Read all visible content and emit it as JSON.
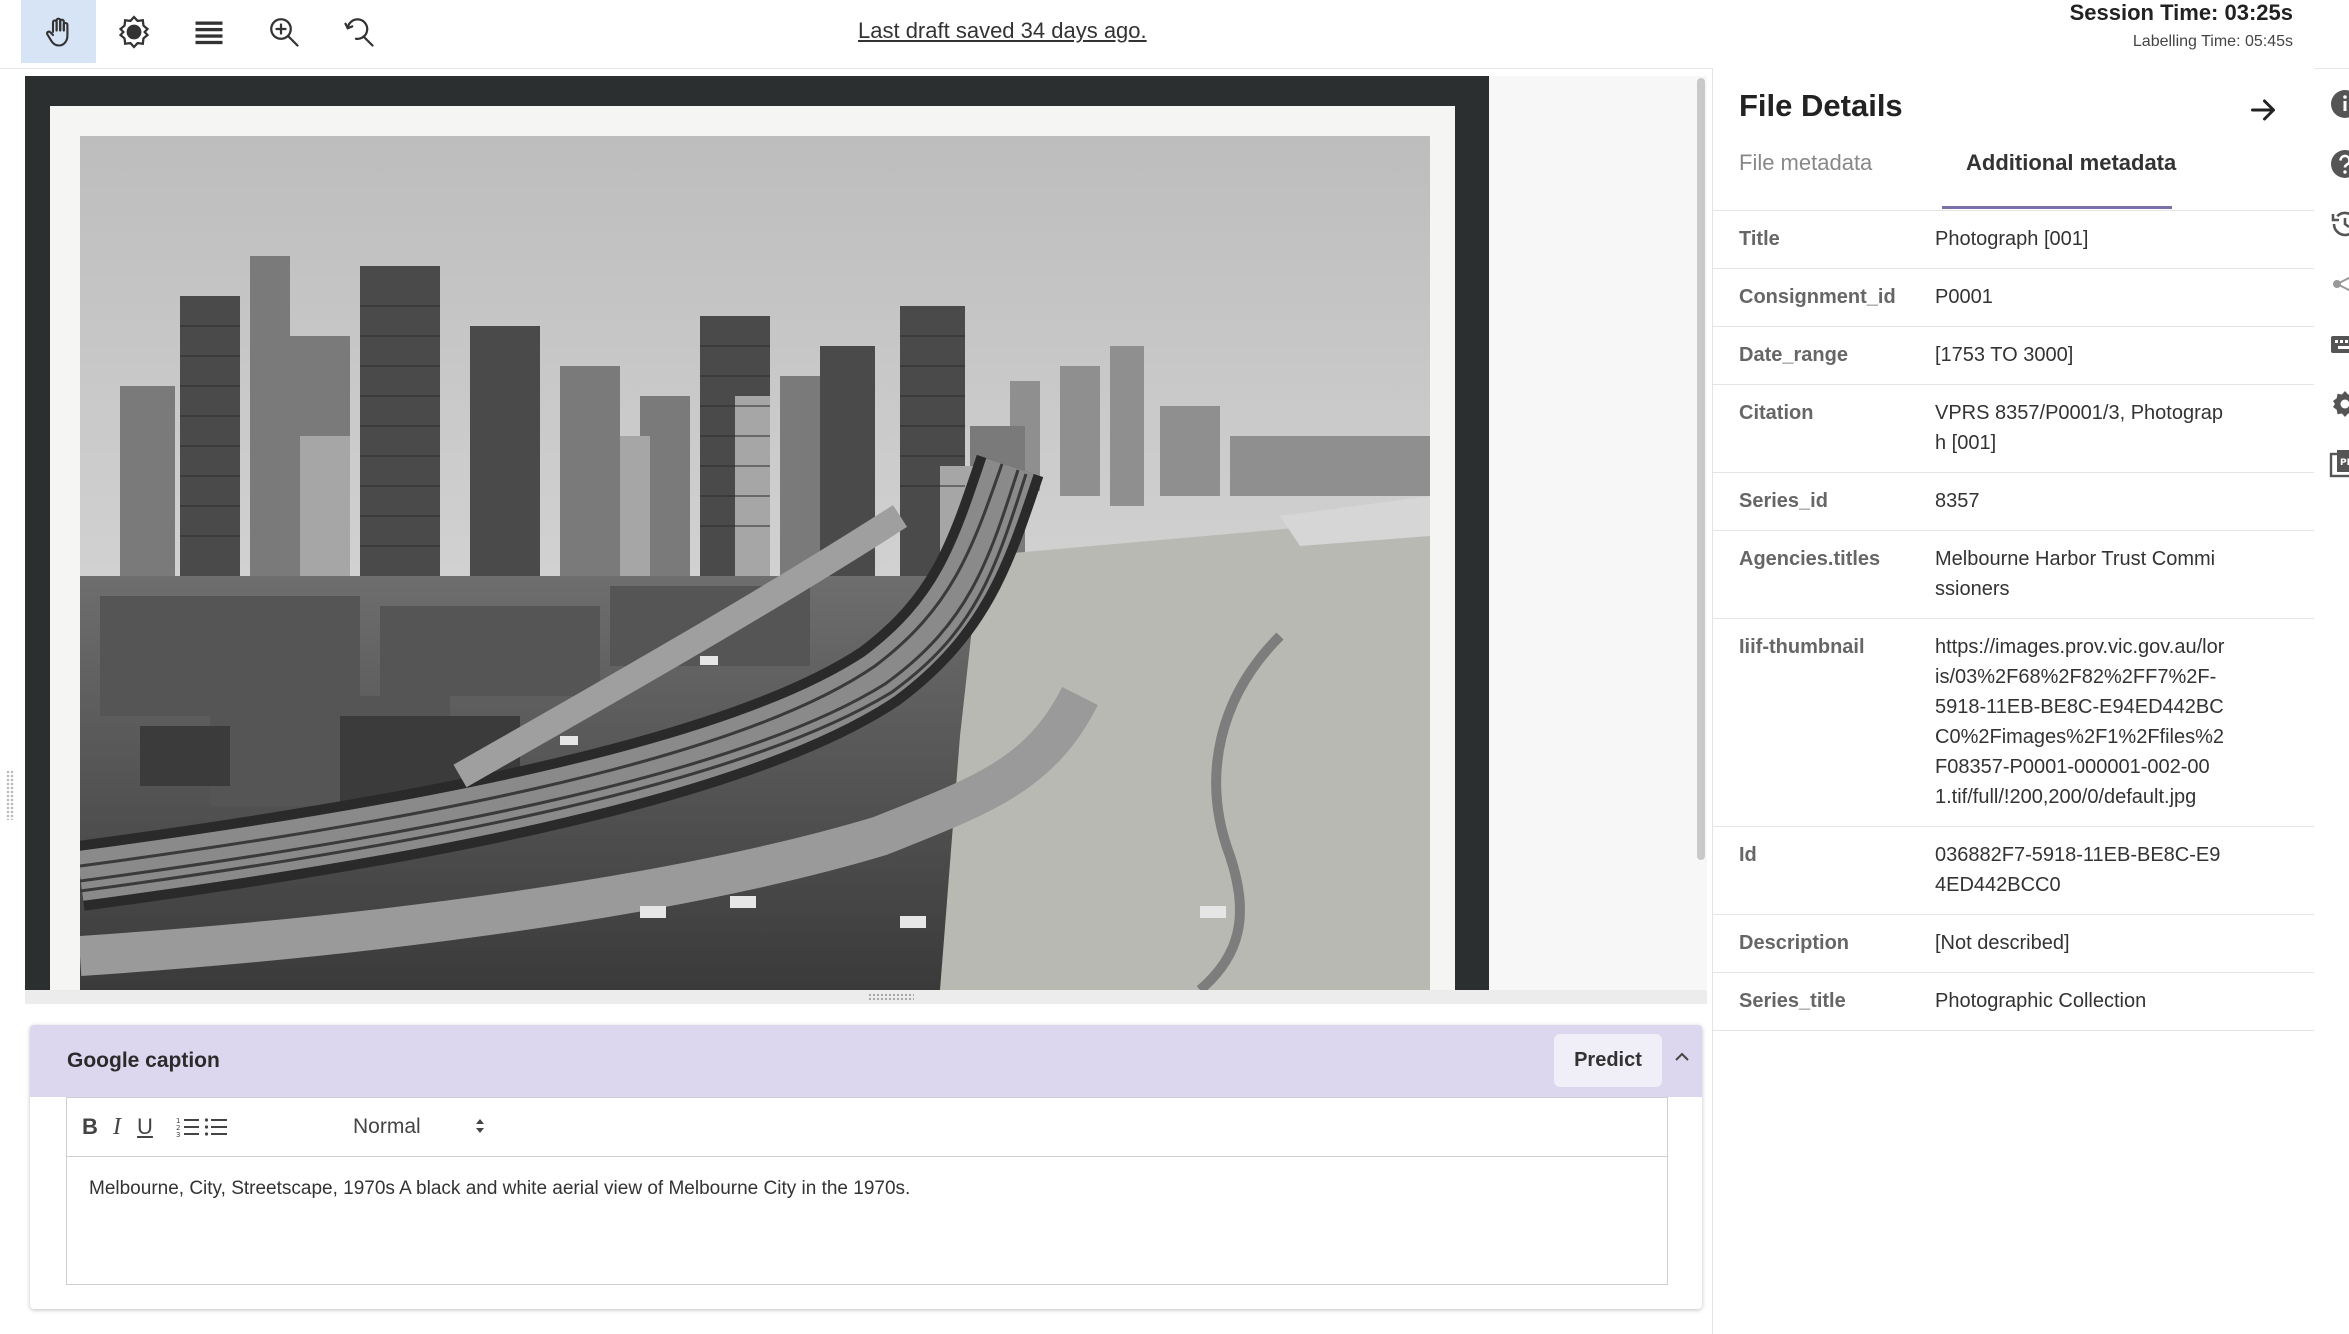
{
  "toolbar": {
    "tools": [
      {
        "name": "pan",
        "icon": "hand-icon",
        "active": true
      },
      {
        "name": "brightness",
        "icon": "brightness-icon",
        "active": false
      },
      {
        "name": "layers",
        "icon": "layers-icon",
        "active": false
      },
      {
        "name": "zoom-in",
        "icon": "zoom-in-icon",
        "active": false
      },
      {
        "name": "zoom-reset",
        "icon": "zoom-reset-icon",
        "active": false
      }
    ],
    "draft_status": "Last draft saved 34 days ago.",
    "session_time": "Session Time: 03:25s",
    "labelling_time": "Labelling Time: 05:45s"
  },
  "caption": {
    "title": "Google caption",
    "predict_label": "Predict",
    "style_value": "Normal",
    "text": "Melbourne, City, Streetscape, 1970s A black and white aerial view of Melbourne City in the 1970s.",
    "format_buttons": [
      {
        "label": "B",
        "icon": "bold-icon"
      },
      {
        "label": "I",
        "icon": "italic-icon"
      },
      {
        "label": "U",
        "icon": "underline-icon"
      }
    ]
  },
  "details": {
    "title": "File Details",
    "tabs": [
      {
        "label": "File metadata",
        "active": false
      },
      {
        "label": "Additional metadata",
        "active": true
      }
    ],
    "rows": [
      {
        "key": "Title",
        "value": "Photograph [001]"
      },
      {
        "key": "Consignment_id",
        "value": "P0001"
      },
      {
        "key": "Date_range",
        "value": "[1753 TO 3000]"
      },
      {
        "key": "Citation",
        "value": "VPRS 8357/P0001/3, Photograph [001]"
      },
      {
        "key": "Series_id",
        "value": "8357"
      },
      {
        "key": "Agencies.titles",
        "value": "Melbourne Harbor Trust Commissioners"
      },
      {
        "key": "Iiif-thumbnail",
        "value": "https://images.prov.vic.gov.au/loris/03%2F68%2F82%2FF7%2F-5918-11EB-BE8C-E94ED442BCC0%2Fimages%2F1%2Ffiles%2F08357-P0001-000001-002-001.tif/full/!200,200/0/default.jpg"
      },
      {
        "key": "Id",
        "value": "036882F7-5918-11EB-BE8C-E94ED442BCC0"
      },
      {
        "key": "Description",
        "value": "[Not described]"
      },
      {
        "key": "Series_title",
        "value": "Photographic Collection"
      }
    ]
  },
  "sidebar_icons": [
    "info-icon",
    "help-icon",
    "history-icon",
    "share-icon",
    "keyboard-icon",
    "settings-icon",
    "pdf-icon"
  ],
  "colors": {
    "accent": "#7a6fa8",
    "caption_header": "#dcd6ee",
    "active_tool": "#d6e4f6"
  }
}
